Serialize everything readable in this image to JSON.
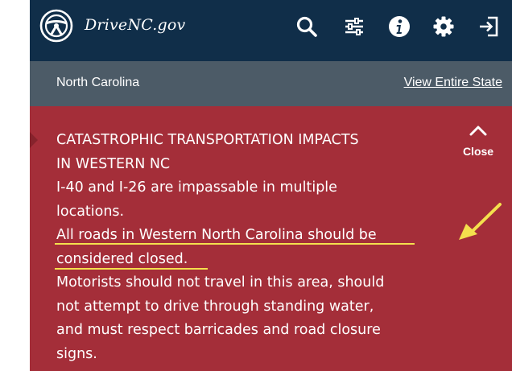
{
  "header": {
    "brand": "DriveNC.gov",
    "icons": [
      "steering-wheel-logo",
      "search-icon",
      "filter-sliders-icon",
      "info-icon",
      "gear-icon",
      "sign-in-icon"
    ]
  },
  "subheader": {
    "region": "North Carolina",
    "view_link": "View Entire State"
  },
  "alert": {
    "lines": [
      "CATASTROPHIC TRANSPORTATION IMPACTS",
      "IN WESTERN NC",
      "I-40 and I-26 are impassable in multiple",
      "locations.",
      "All roads in Western North Carolina should be",
      "considered closed.",
      "Motorists should not travel in this area, should",
      "not attempt to drive through standing water,",
      "and must respect barricades and road closure",
      "signs."
    ],
    "close_label": "Close"
  },
  "colors": {
    "header_bg": "#102e49",
    "subheader_bg": "#4c5b67",
    "alert_bg": "#a42e39",
    "annotation": "#f4e04d"
  }
}
